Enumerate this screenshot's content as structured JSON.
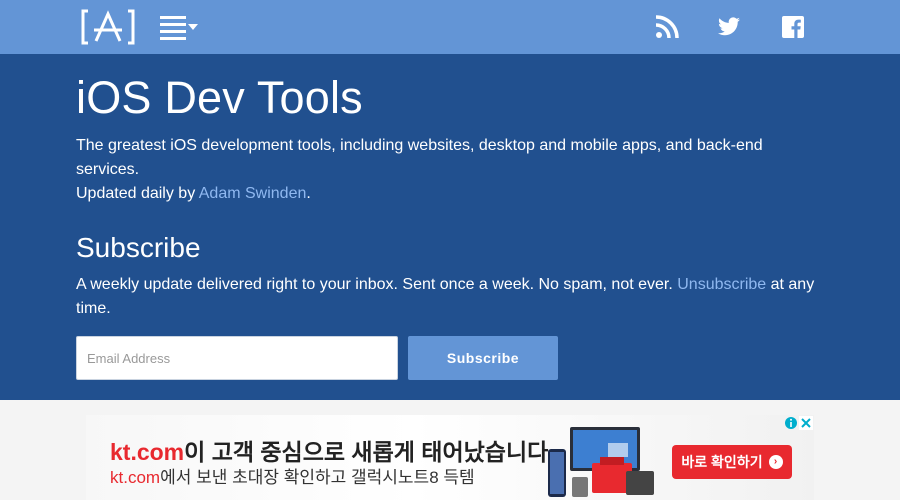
{
  "header": {
    "logo_icon": "app-store-bracket-logo-icon",
    "menu_icon": "hamburger-menu-icon",
    "social_icons": [
      "rss-icon",
      "twitter-icon",
      "facebook-icon"
    ]
  },
  "hero": {
    "title": "iOS Dev Tools",
    "tagline_text": "The greatest iOS development tools, including websites, desktop and mobile apps, and back-end services.",
    "updated_prefix": "Updated daily by ",
    "author_link": "Adam Swinden",
    "updated_suffix": "."
  },
  "subscribe": {
    "title": "Subscribe",
    "desc_text": "A weekly update delivered right to your inbox. Sent once a week. No spam, not ever. ",
    "unsubscribe_link": "Unsubscribe",
    "desc_suffix": " at any time.",
    "email_placeholder": "Email Address",
    "email_value": "",
    "button_label": "Subscribe"
  },
  "ad": {
    "line1_brand": "kt.com",
    "line1_rest": "이 고객 중심으로 새롭게 태어났습니다",
    "line2_brand": "kt.com",
    "line2_rest": "에서 보낸 초대장 확인하고 갤럭시노트8 득템",
    "cta_label": "바로 확인하기",
    "info_icon": "adchoices-info-icon",
    "close_icon": "close-icon"
  },
  "colors": {
    "topbar": "#6395d6",
    "hero_bg": "#21508f",
    "link": "#8fb8f0",
    "button": "#6395d6",
    "ad_accent": "#e8292f"
  }
}
